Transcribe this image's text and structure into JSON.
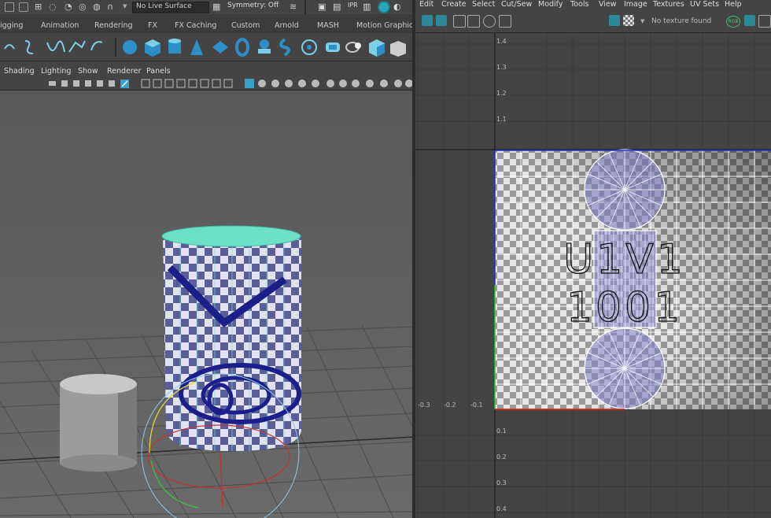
{
  "status_line": {
    "live_surface": "No Live Surface",
    "symmetry": "Symmetry: Off"
  },
  "shelf_tabs": [
    "igging",
    "Animation",
    "Rendering",
    "FX",
    "FX Caching",
    "Custom",
    "Arnold",
    "MASH",
    "Motion Graphics"
  ],
  "shelf_icons": [
    "curve-cv-icon",
    "curve-ep-icon",
    "bezier-icon",
    "pencil-curve-icon",
    "arc-icon",
    "sphere-icon",
    "cube-icon",
    "cylinder-icon",
    "cone-icon",
    "plane-icon",
    "torus-icon",
    "type-icon",
    "svg-icon",
    "sculpt-icon",
    "bevel-icon",
    "bridge-icon",
    "quad-draw-icon"
  ],
  "viewport_menu": [
    "Shading",
    "Lighting",
    "Show",
    "Renderer",
    "Panels"
  ],
  "uv_editor": {
    "menu": [
      "Edit",
      "Create",
      "Select",
      "Cut/Sew",
      "Modify",
      "Tools",
      "View",
      "Image",
      "Textures",
      "UV Sets",
      "Help"
    ],
    "texture_status": "No texture found",
    "rgb_label": "RGB",
    "tile_label_line1": "U1V1",
    "tile_label_line2": "1001",
    "v_ticks": [
      "1.4",
      "1.3",
      "1.2",
      "1.1",
      "0.1",
      "0.2",
      "0.3",
      "0.4"
    ],
    "u_ticks": [
      "-0.3",
      "-0.2",
      "-0.1"
    ]
  },
  "colors": {
    "uv_shell_fill": "#8080c8",
    "checker_light": "#e6e6e6",
    "checker_dark": "#9a9a9a",
    "u_axis": "#cc2222",
    "v_axis_green": "#22cc22",
    "v_axis_blue": "#2233cc",
    "manipulator_ring": "#8cc8e8"
  }
}
